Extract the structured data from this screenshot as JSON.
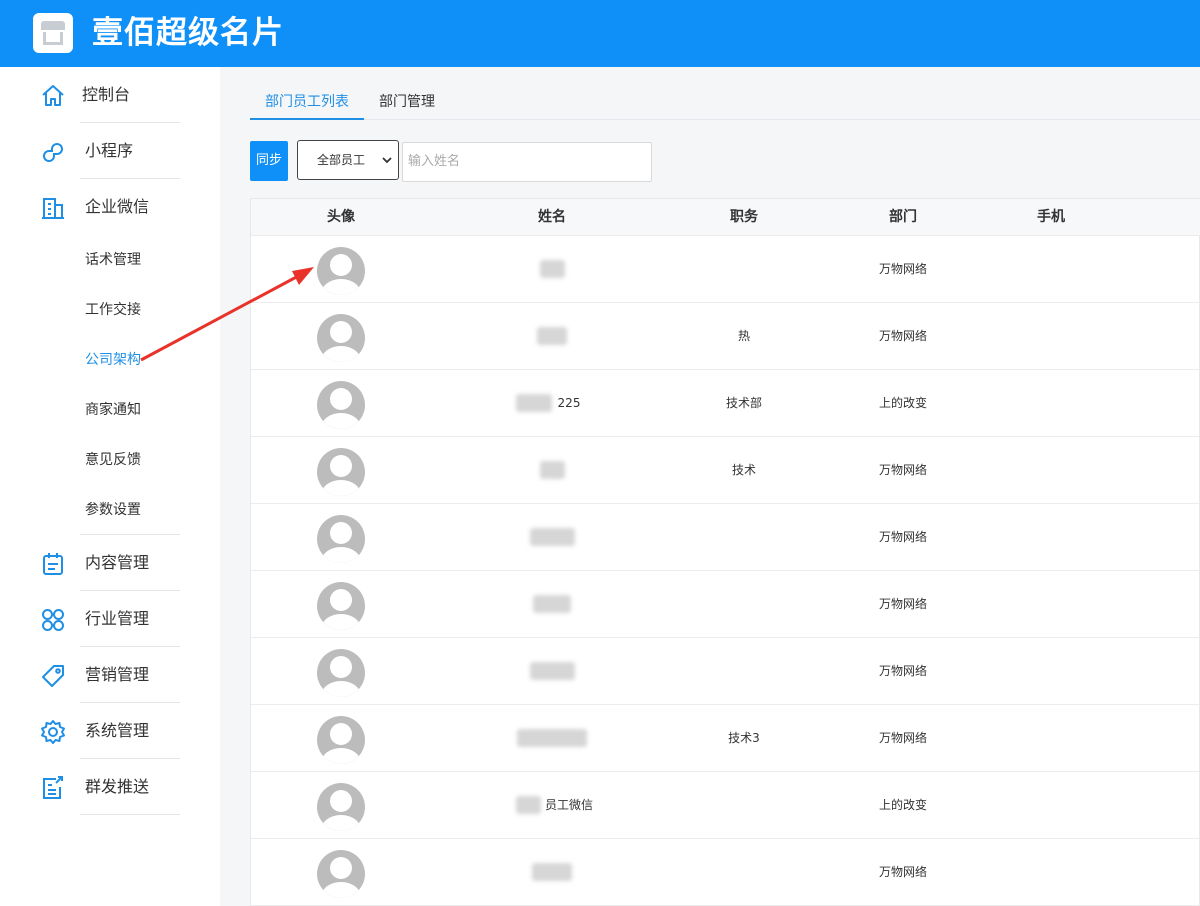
{
  "app": {
    "title": "壹佰超级名片"
  },
  "sidebar": {
    "items": [
      {
        "label": "控制台",
        "icon": "home-icon"
      },
      {
        "label": "小程序",
        "icon": "link-icon"
      },
      {
        "label": "企业微信",
        "icon": "building-icon"
      }
    ],
    "subitems": [
      {
        "label": "话术管理"
      },
      {
        "label": "工作交接"
      },
      {
        "label": "公司架构",
        "active": true
      },
      {
        "label": "商家通知"
      },
      {
        "label": "意见反馈"
      },
      {
        "label": "参数设置"
      }
    ],
    "items2": [
      {
        "label": "内容管理",
        "icon": "clipboard-icon"
      },
      {
        "label": "行业管理",
        "icon": "apps-icon"
      },
      {
        "label": "营销管理",
        "icon": "tag-icon"
      },
      {
        "label": "系统管理",
        "icon": "gear-icon"
      },
      {
        "label": "群发推送",
        "icon": "broadcast-icon"
      }
    ]
  },
  "tabs": [
    {
      "label": "部门员工列表",
      "active": true
    },
    {
      "label": "部门管理"
    }
  ],
  "toolbar": {
    "sync_label": "同步",
    "filter_value": "全部员工",
    "search_placeholder": "输入姓名"
  },
  "table": {
    "columns": [
      "头像",
      "姓名",
      "职务",
      "部门",
      "手机"
    ],
    "rows": [
      {
        "name": "",
        "title": "",
        "dept": "万物网络",
        "phone": ""
      },
      {
        "name": "",
        "title": "热",
        "dept": "万物网络",
        "phone": ""
      },
      {
        "name": "225",
        "title": "技术部",
        "dept": "上的改变",
        "phone": ""
      },
      {
        "name": "",
        "title": "技术",
        "dept": "万物网络",
        "phone": ""
      },
      {
        "name": "",
        "title": "",
        "dept": "万物网络",
        "phone": ""
      },
      {
        "name": "",
        "title": "",
        "dept": "万物网络",
        "phone": ""
      },
      {
        "name": "",
        "title": "",
        "dept": "万物网络",
        "phone": ""
      },
      {
        "name": "",
        "title": "技术3",
        "dept": "万物网络",
        "phone": ""
      },
      {
        "name": "员工微信",
        "title": "",
        "dept": "上的改变",
        "phone": ""
      },
      {
        "name": "",
        "title": "",
        "dept": "万物网络",
        "phone": ""
      }
    ]
  },
  "colors": {
    "brand": "#0f8ff8",
    "active": "#1f8fe6",
    "annotation": "#e8322a"
  }
}
